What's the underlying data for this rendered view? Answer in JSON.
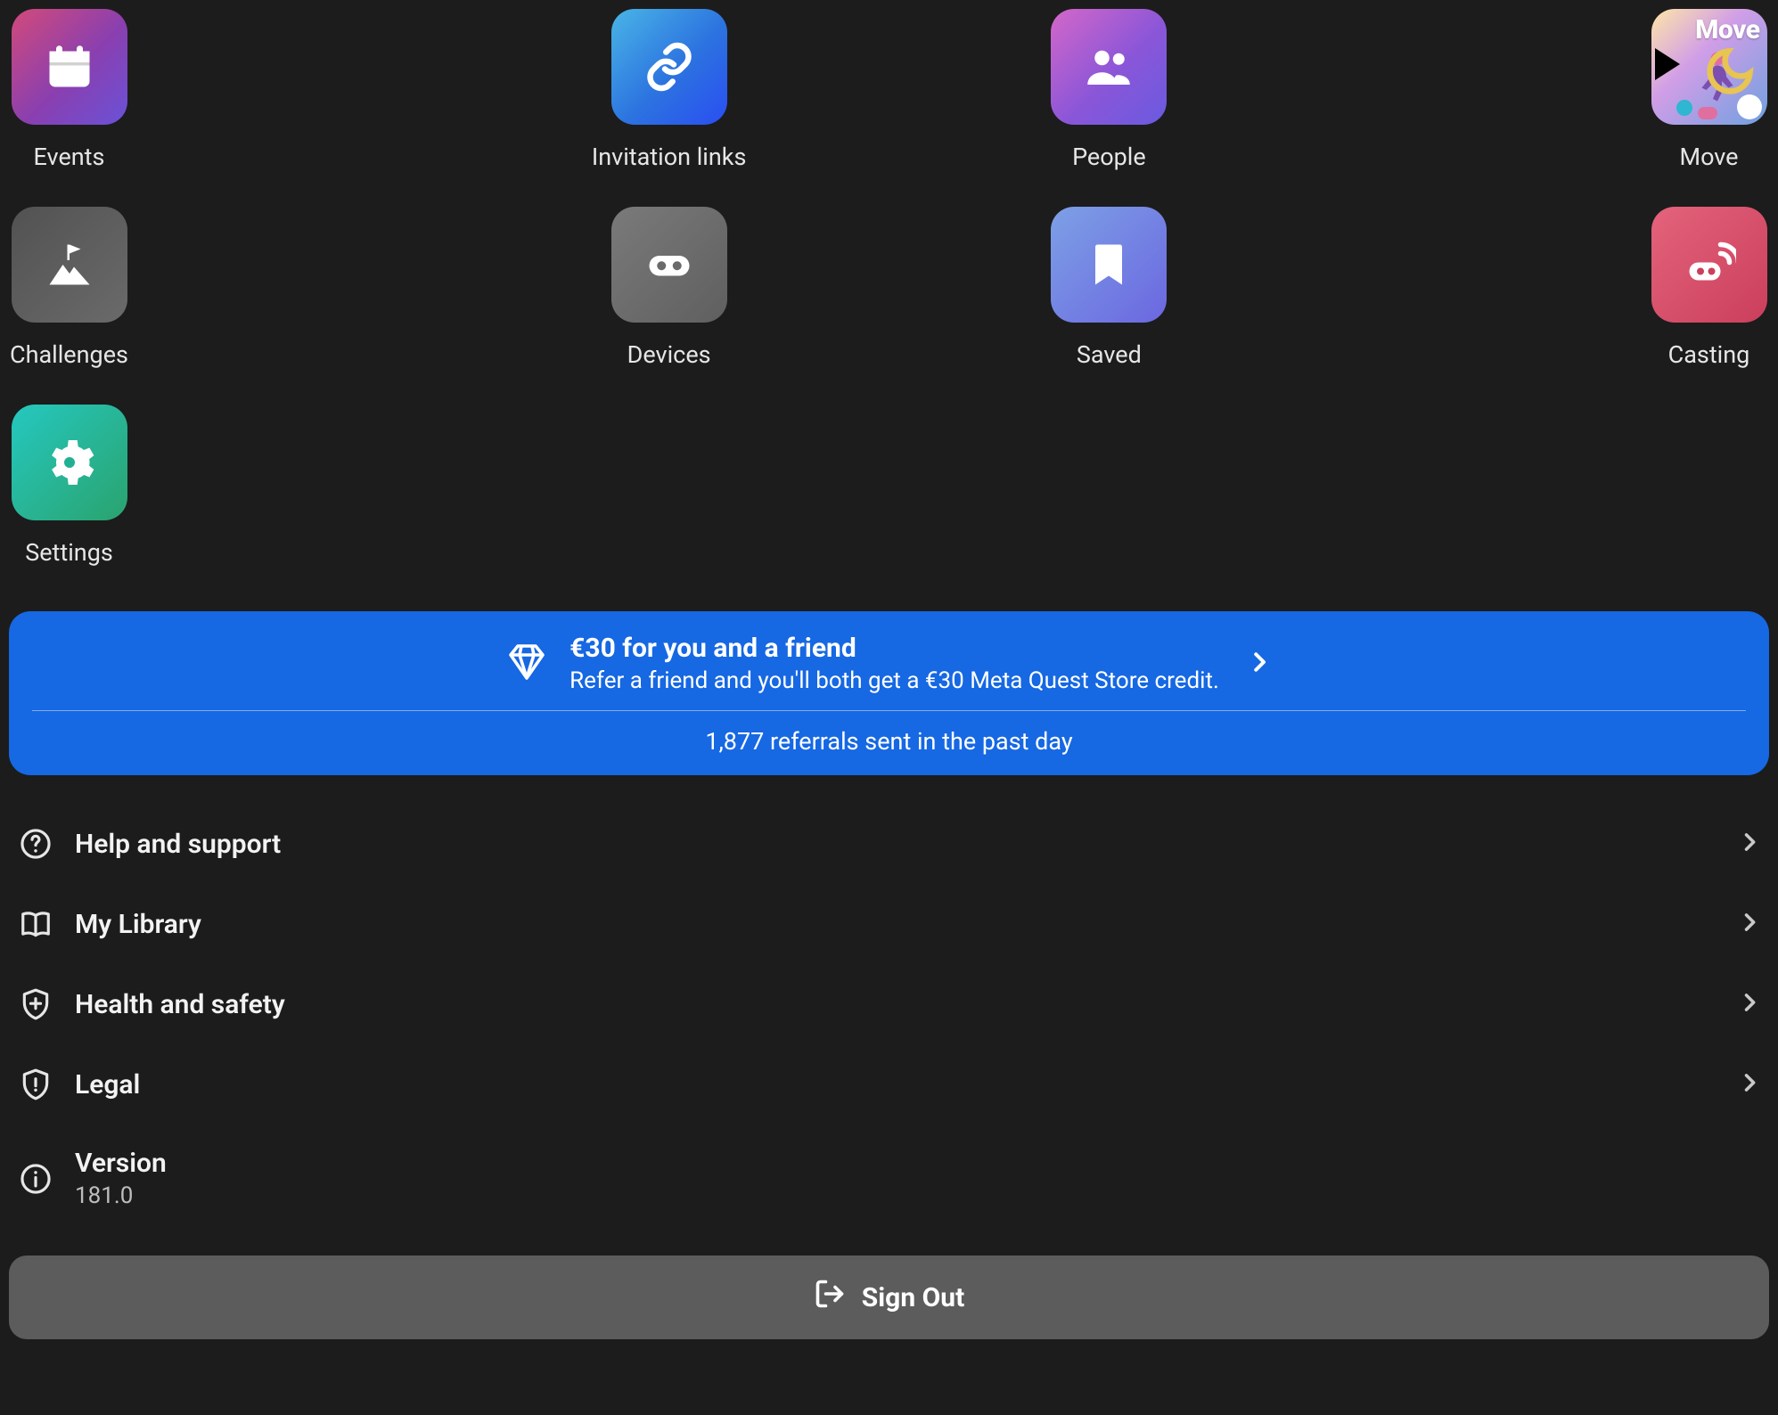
{
  "apps": [
    {
      "label": "Events"
    },
    {
      "label": "Invitation links"
    },
    {
      "label": "People"
    },
    {
      "label": "Move"
    },
    {
      "label": "Challenges"
    },
    {
      "label": "Devices"
    },
    {
      "label": "Saved"
    },
    {
      "label": "Casting"
    },
    {
      "label": "Settings"
    }
  ],
  "banner": {
    "title": "€30 for you and a friend",
    "subtitle": "Refer a friend and you'll both get a €30 Meta Quest Store credit.",
    "stats": "1,877 referrals sent in the past day"
  },
  "menu": {
    "help": "Help and support",
    "library": "My Library",
    "health": "Health and safety",
    "legal": "Legal",
    "version_label": "Version",
    "version_value": "181.0"
  },
  "signout": "Sign Out",
  "move_tile_text": "Move"
}
